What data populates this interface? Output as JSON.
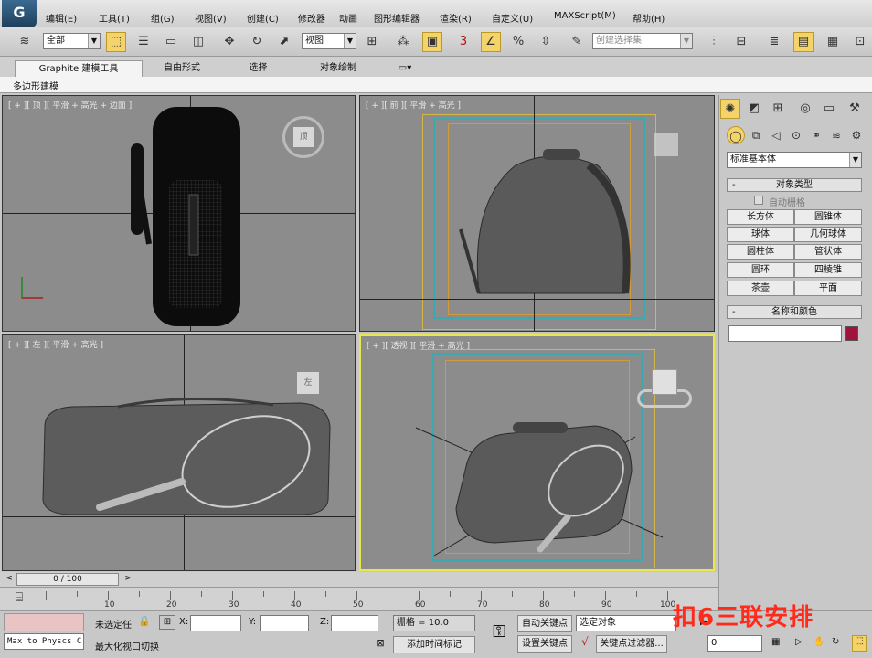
{
  "menu": {
    "logo": "G",
    "items": [
      "编辑(E)",
      "工具(T)",
      "组(G)",
      "视图(V)",
      "创建(C)",
      "修改器",
      "动画",
      "图形编辑器",
      "渲染(R)",
      "自定义(U)",
      "MAXScript(M)",
      "帮助(H)"
    ]
  },
  "toolbar": {
    "selection_filter": "全部",
    "reference_coord": "视图",
    "snap_label": "3",
    "named_selection_placeholder": "创建选择集"
  },
  "ribbon": {
    "tabs": [
      "Graphite 建模工具",
      "自由形式",
      "选择",
      "对象绘制"
    ],
    "sub_label": "多边形建模"
  },
  "viewports": {
    "top": "[ + ][ 顶 ][ 平滑 + 高光 + 边面 ]",
    "front": "[ + ][ 前 ][ 平滑 + 高光 ]",
    "left": "[ + ][ 左 ][ 平滑 + 高光 ]",
    "persp": "[ + ][ 透视 ][ 平滑 + 高光 ]",
    "cube_top": "顶",
    "cube_left": "左"
  },
  "command_panel": {
    "dropdown": "标准基本体",
    "object_type_title": "对象类型",
    "auto_grid": "自动栅格",
    "primitives": [
      "长方体",
      "圆锥体",
      "球体",
      "几何球体",
      "圆柱体",
      "管状体",
      "圆环",
      "四棱锥",
      "茶壶",
      "平面"
    ],
    "name_color_title": "名称和颜色",
    "object_color": "#a0143c"
  },
  "timeline": {
    "slider": "0 / 100",
    "ticks": [
      "10",
      "20",
      "30",
      "40",
      "50",
      "60",
      "70",
      "80",
      "90",
      "100"
    ]
  },
  "status": {
    "maxscript": "Max to Physcs C",
    "selection_state": "未选定任",
    "x_label": "X:",
    "y_label": "Y:",
    "z_label": "Z:",
    "grid": "栅格 = 10.0",
    "auto_key": "自动关键点",
    "selected_object": "选定对象",
    "set_key": "设置关键点",
    "key_filters": "关键点过滤器...",
    "frame": "0",
    "prompt": "最大化视口切换",
    "add_time_tag": "添加时间标记"
  },
  "watermark": "扣6三联安排"
}
